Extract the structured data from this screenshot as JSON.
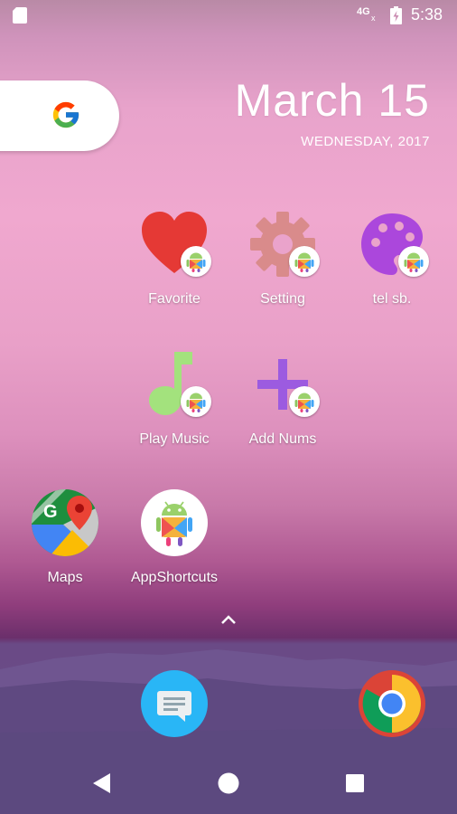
{
  "status_bar": {
    "network": "4G",
    "network_x": "x",
    "time": "5:38"
  },
  "search_widget": {
    "icon": "google-g-icon"
  },
  "date_widget": {
    "date": "March 15",
    "weekday_year": "WEDNESDAY, 2017"
  },
  "apps": [
    {
      "label": "Favorite",
      "icon": "heart-icon",
      "color": "#e53935"
    },
    {
      "label": "Setting",
      "icon": "gear-icon",
      "color": "#d98b8b"
    },
    {
      "label": "tel sb.",
      "icon": "palette-icon",
      "color": "#b147d6"
    },
    {
      "label": "Play Music",
      "icon": "music-note-icon",
      "color": "#9ee27a"
    },
    {
      "label": "Add Nums",
      "icon": "plus-icon",
      "color": "#9c5be0"
    },
    {
      "label": "Maps",
      "icon": "maps-icon"
    },
    {
      "label": "AppShortcuts",
      "icon": "android-icon"
    }
  ],
  "dock": [
    {
      "icon": "messages-icon",
      "color": "#29b6f6"
    },
    {
      "icon": "chrome-icon"
    }
  ],
  "nav_bar": {
    "back": "back-icon",
    "home": "home-icon",
    "recents": "recents-icon"
  }
}
